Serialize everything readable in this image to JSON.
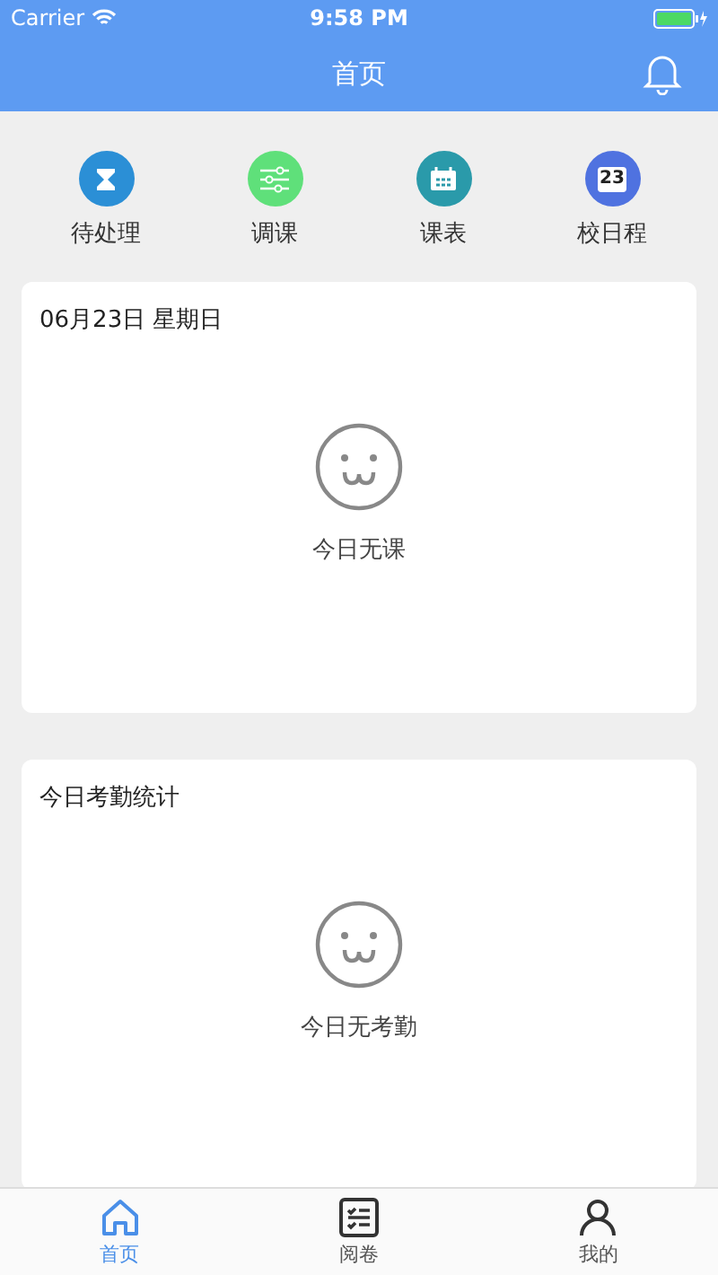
{
  "status_bar": {
    "carrier": "Carrier",
    "time": "9:58 PM"
  },
  "nav_bar": {
    "title": "首页"
  },
  "shortcuts": [
    {
      "label": "待处理",
      "kind": "hourglass",
      "color": "#2b8fd6"
    },
    {
      "label": "调课",
      "kind": "sliders",
      "color": "#5fe07a"
    },
    {
      "label": "课表",
      "kind": "timetable",
      "color": "#2a9aaa"
    },
    {
      "label": "校日程",
      "kind": "date",
      "color": "#4f72e0",
      "date": "23"
    }
  ],
  "cards": [
    {
      "title": "06月23日  星期日",
      "empty_text": "今日无课"
    },
    {
      "title": "今日考勤统计",
      "empty_text": "今日无考勤"
    }
  ],
  "tab_bar": [
    {
      "label": "首页",
      "kind": "home",
      "selected": true
    },
    {
      "label": "阅卷",
      "kind": "list",
      "selected": false
    },
    {
      "label": "我的",
      "kind": "person",
      "selected": false
    }
  ]
}
